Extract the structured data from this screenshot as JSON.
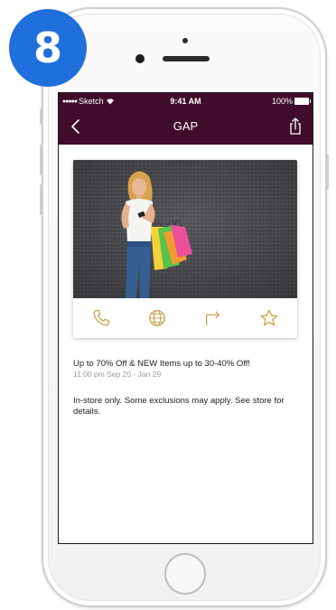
{
  "step_badge": "8",
  "status_bar": {
    "carrier": "Sketch",
    "time": "9:41 AM",
    "battery": "100%"
  },
  "nav": {
    "title": "GAP",
    "back_icon": "chevron-left-icon",
    "share_icon": "share-icon"
  },
  "card": {
    "image": "woman-with-shopping-bags-photo",
    "actions": [
      {
        "icon": "phone-icon"
      },
      {
        "icon": "globe-icon"
      },
      {
        "icon": "directions-icon"
      },
      {
        "icon": "star-icon"
      }
    ]
  },
  "deal": {
    "title": "Up to 70% Off & NEW Items up to 30-40% Off!",
    "date": "11:00 pm Sep 20 - Jan 29",
    "description": "In-store only. Some exclusions may apply. See store for details."
  },
  "colors": {
    "nav_background": "#3f0d2b",
    "icon_gold": "#c8a24a",
    "badge_blue": "#1f6fdc"
  }
}
